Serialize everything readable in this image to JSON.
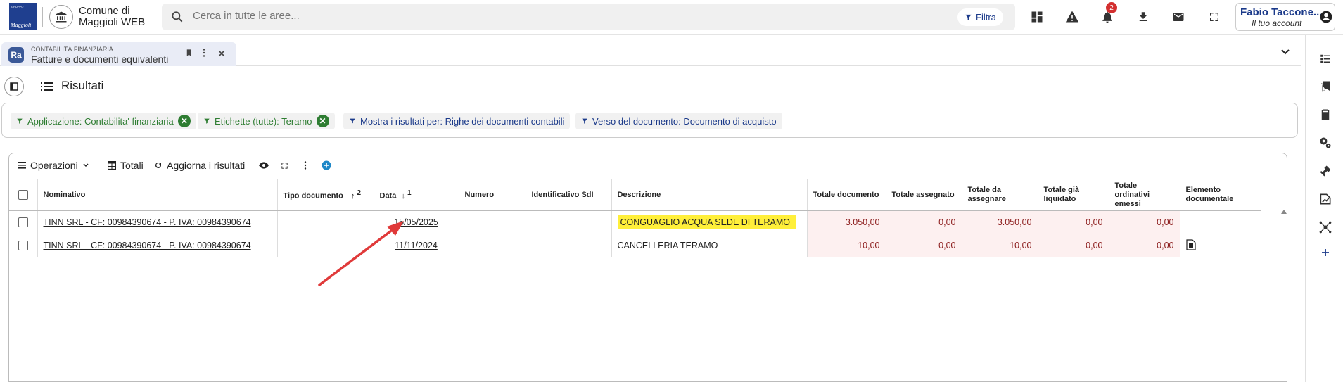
{
  "header": {
    "logo_top": "GRUPPO",
    "logo_text": "Maggioli",
    "app_title_line1": "Comune di",
    "app_title_line2": "Maggioli WEB",
    "search_placeholder": "Cerca in tutte le aree...",
    "filter_label": "Filtra",
    "notifications_count": "2",
    "account_name": "Fabio Taccone...",
    "account_sub": "Il tuo account"
  },
  "tab": {
    "logo": "Ra",
    "category": "CONTABILITÀ FINANZIARIA",
    "title": "Fatture e documenti equivalenti"
  },
  "page": {
    "title": "Risultati"
  },
  "filters": [
    {
      "label": "Applicazione: Contabilita' finanziaria"
    },
    {
      "label": "Etichette (tutte): Teramo"
    },
    {
      "label": "Mostra i risultati per: Righe dei documenti contabili"
    },
    {
      "label": "Verso del documento: Documento di acquisto"
    }
  ],
  "toolbar": {
    "operations": "Operazioni",
    "totals": "Totali",
    "refresh": "Aggiorna i risultati"
  },
  "table": {
    "columns": {
      "nominativo": "Nominativo",
      "tipo": "Tipo documento",
      "tipo_sort": "2",
      "data": "Data",
      "data_sort": "1",
      "numero": "Numero",
      "sdi": "Identificativo SdI",
      "descrizione": "Descrizione",
      "totale": "Totale documento",
      "assegnato": "Totale assegnato",
      "da_assegnare": "Totale da assegnare",
      "liquidato": "Totale già liquidato",
      "ordinativi": "Totale ordinativi emessi",
      "elemento": "Elemento documentale"
    },
    "rows": [
      {
        "nominativo": "TINN SRL - CF: 00984390674 - P. IVA: 00984390674",
        "tipo": "",
        "data": "15/05/2025",
        "numero": "",
        "sdi": "",
        "descrizione": "CONGUAGLIO ACQUA SEDE DI TERAMO",
        "totale": "3.050,00",
        "assegnato": "0,00",
        "da_assegnare": "3.050,00",
        "liquidato": "0,00",
        "ordinativi": "0,00"
      },
      {
        "nominativo": "TINN SRL - CF: 00984390674 - P. IVA: 00984390674",
        "tipo": "",
        "data": "11/11/2024",
        "numero": "",
        "sdi": "",
        "descrizione": "CANCELLERIA TERAMO",
        "totale": "10,00",
        "assegnato": "0,00",
        "da_assegnare": "10,00",
        "liquidato": "0,00",
        "ordinativi": "0,00"
      }
    ]
  },
  "colors": {
    "brand": "#1f3f8f",
    "highlight": "#ffef3a",
    "annotation_arrow": "#e03a3a",
    "chip_green": "#2e7d32"
  }
}
